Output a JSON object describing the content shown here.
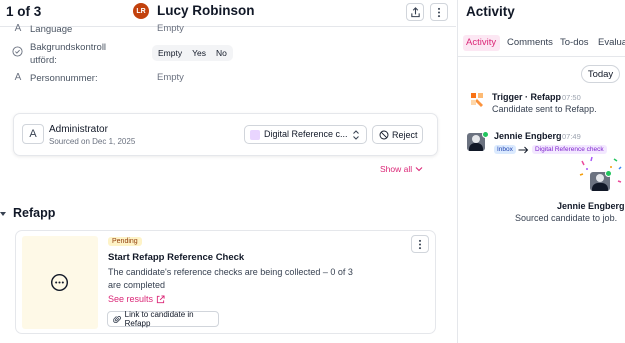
{
  "header": {
    "counter": "1 of 3",
    "candidate_initials": "LR",
    "candidate_name": "Lucy Robinson"
  },
  "fields": {
    "language": {
      "label": "Language",
      "value": "Empty"
    },
    "background_check": {
      "label": "Bakgrundskontroll utförd:",
      "options": [
        "Empty",
        "Yes",
        "No"
      ]
    },
    "personnummer": {
      "label": "Personnummer:",
      "value": "Empty"
    }
  },
  "admin_card": {
    "initial": "A",
    "title": "Administrator",
    "subtitle": "Sourced on Dec 1, 2025",
    "stage_select": "Digital Reference c...",
    "reject_label": "Reject"
  },
  "show_all": "Show all",
  "refapp": {
    "section_title": "Refapp",
    "badge": "Pending",
    "title": "Start Refapp Reference Check",
    "description_line1": "The candidate's reference checks are being collected – 0 of 3",
    "description_line2": "are completed",
    "see_results": "See results",
    "link_button": "Link to candidate in Refapp"
  },
  "activity": {
    "title": "Activity",
    "tabs": [
      "Activity",
      "Comments",
      "To-dos",
      "Evalua"
    ],
    "active_tab": "Activity",
    "date_chip": "Today",
    "items": [
      {
        "actor": "Trigger · Refapp",
        "time": "07:50",
        "text": "Candidate sent to Refapp."
      },
      {
        "actor": "Jennie Engberg",
        "time": "07:49",
        "from_stage": "Inbox",
        "to_stage": "Digital Reference check"
      }
    ],
    "celebration": {
      "name": "Jennie Engberg",
      "text": "Sourced candidate to job."
    }
  },
  "colors": {
    "accent_pink": "#db2777",
    "tab_active_bg": "#fce7f3",
    "refapp_orange": "#f97316",
    "online_green": "#22c55e",
    "pending_bg": "#fef3c7",
    "avatar_bg": "#c2410c"
  }
}
